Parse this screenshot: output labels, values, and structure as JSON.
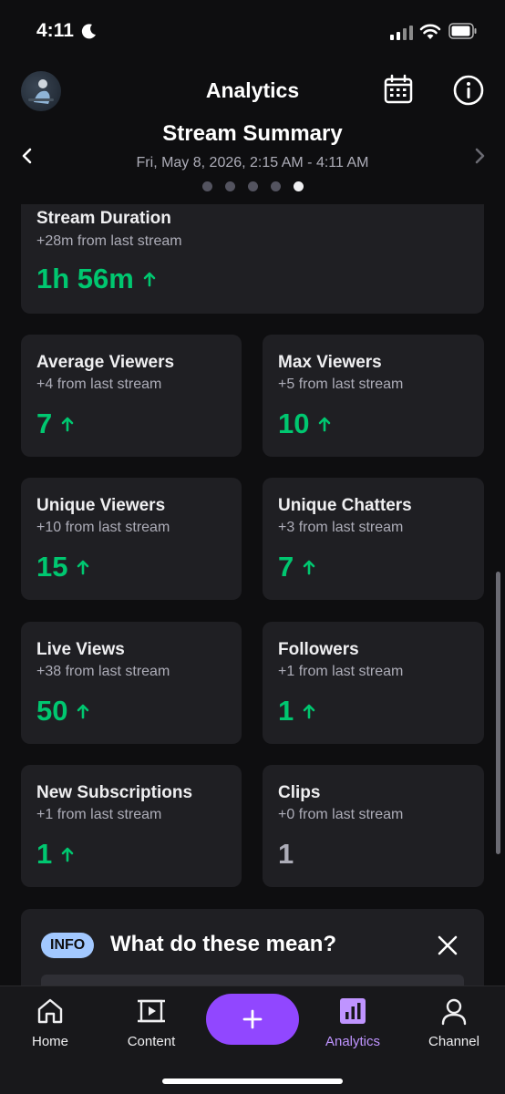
{
  "status_bar": {
    "time": "4:11"
  },
  "header": {
    "title": "Analytics"
  },
  "summary": {
    "title": "Stream Summary",
    "date_range": "Fri, May 8, 2026, 2:15 AM - 4:11 AM",
    "page_dots": 5,
    "active_dot": 5
  },
  "stats": [
    {
      "title": "Stream Duration",
      "delta": "+28m from last stream",
      "value": "1h 56m",
      "trend": "up"
    },
    {
      "title": "Average Viewers",
      "delta": "+4 from last stream",
      "value": "7",
      "trend": "up"
    },
    {
      "title": "Max Viewers",
      "delta": "+5 from last stream",
      "value": "10",
      "trend": "up"
    },
    {
      "title": "Unique Viewers",
      "delta": "+10 from last stream",
      "value": "15",
      "trend": "up"
    },
    {
      "title": "Unique Chatters",
      "delta": "+3 from last stream",
      "value": "7",
      "trend": "up"
    },
    {
      "title": "Live Views",
      "delta": "+38 from last stream",
      "value": "50",
      "trend": "up"
    },
    {
      "title": "Followers",
      "delta": "+1 from last stream",
      "value": "1",
      "trend": "up"
    },
    {
      "title": "New Subscriptions",
      "delta": "+1 from last stream",
      "value": "1",
      "trend": "up"
    },
    {
      "title": "Clips",
      "delta": "+0 from last stream",
      "value": "1",
      "trend": "none"
    }
  ],
  "info": {
    "badge": "INFO",
    "title": "What do these mean?"
  },
  "nav": {
    "items": [
      {
        "label": "Home",
        "icon": "home-icon"
      },
      {
        "label": "Content",
        "icon": "content-icon"
      },
      {
        "label": "Analytics",
        "icon": "analytics-icon",
        "active": true
      },
      {
        "label": "Channel",
        "icon": "channel-icon"
      }
    ],
    "create_label": "+"
  },
  "colors": {
    "background": "#0e0e10",
    "card": "#1f1f23",
    "positive": "#00c770",
    "accent": "#9147ff",
    "accent_light": "#bf94ff",
    "info_badge": "#a2c8ff"
  }
}
